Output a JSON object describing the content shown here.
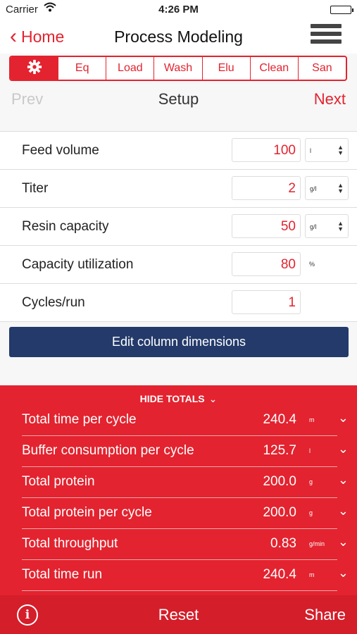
{
  "status": {
    "carrier": "Carrier",
    "time": "4:26 PM"
  },
  "nav": {
    "back_label": "Home",
    "title": "Process Modeling",
    "menu_icon": "hamburger-menu-icon"
  },
  "segments": [
    {
      "label": "",
      "icon": "gear-icon",
      "active": true
    },
    {
      "label": "Eq"
    },
    {
      "label": "Load"
    },
    {
      "label": "Wash"
    },
    {
      "label": "Elu"
    },
    {
      "label": "Clean"
    },
    {
      "label": "San"
    }
  ],
  "pager": {
    "prev": "Prev",
    "step": "Setup",
    "next": "Next"
  },
  "fields": [
    {
      "label": "Feed volume",
      "value": "100",
      "unit": "l",
      "unit_select": true
    },
    {
      "label": "Titer",
      "value": "2",
      "unit": "g/l",
      "unit_select": true
    },
    {
      "label": "Resin capacity",
      "value": "50",
      "unit": "g/l",
      "unit_select": true
    },
    {
      "label": "Capacity utilization",
      "value": "80",
      "unit": "%",
      "unit_select": false
    },
    {
      "label": "Cycles/run",
      "value": "1",
      "unit": "",
      "unit_select": false
    }
  ],
  "edit_button": "Edit column dimensions",
  "totals": {
    "toggle_label": "HIDE TOTALS",
    "rows": [
      {
        "label": "Total time per cycle",
        "value": "240.4",
        "unit": "m"
      },
      {
        "label": "Buffer consumption per cycle",
        "value": "125.7",
        "unit": "l"
      },
      {
        "label": "Total protein",
        "value": "200.0",
        "unit": "g"
      },
      {
        "label": "Total protein per cycle",
        "value": "200.0",
        "unit": "g"
      },
      {
        "label": "Total throughput",
        "value": "0.83",
        "unit": "g/min"
      },
      {
        "label": "Total time run",
        "value": "240.4",
        "unit": "m"
      }
    ]
  },
  "toolbar": {
    "reset": "Reset",
    "share": "Share"
  },
  "colors": {
    "accent": "#e3232f",
    "button": "#233a6a"
  }
}
